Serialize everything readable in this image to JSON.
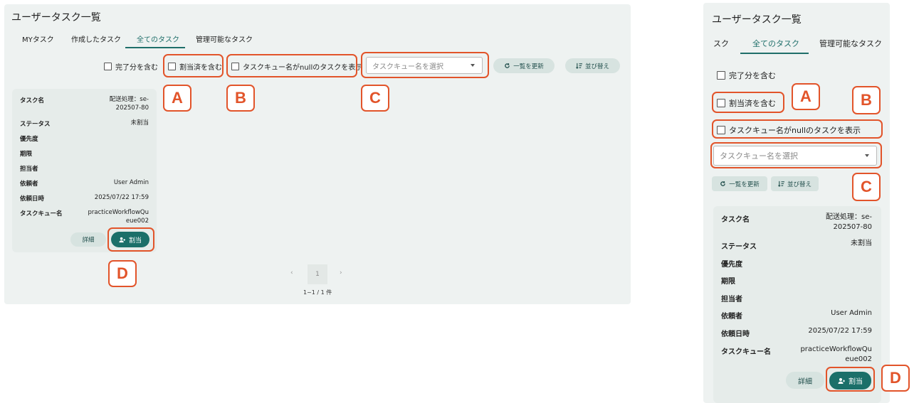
{
  "title": "ユーザータスク一覧",
  "tabs": [
    "MYタスク",
    "作成したタスク",
    "全てのタスク",
    "管理可能なタスク"
  ],
  "tabs_right": [
    "スク",
    "全てのタスク",
    "管理可能なタスク"
  ],
  "filters": {
    "include_completed": "完了分を含む",
    "include_assigned": "割当済を含む",
    "show_null_queue": "タスクキュー名がnullのタスクを表示",
    "queue_placeholder": "タスクキュー名を選択"
  },
  "actions": {
    "refresh": "一覧を更新",
    "sort": "並び替え"
  },
  "task": {
    "labels": [
      "タスク名",
      "ステータス",
      "優先度",
      "期限",
      "担当者",
      "依頼者",
      "依頼日時",
      "タスクキュー名"
    ],
    "name_line1": "配送処理：se-",
    "name_line2": "202507-80",
    "status": "未割当",
    "priority": "",
    "due": "",
    "assignee": "",
    "requester": "User Admin",
    "requested_at": "2025/07/22 17:59",
    "queue_left_1": "practiceWorkflowQu",
    "queue_left_2": "eue002",
    "queue_right_1": "practiceWorkflowQu",
    "queue_right_2": "eue002",
    "detail_button": "詳細",
    "assign_button": "割当"
  },
  "pagination": {
    "page": "1",
    "summary": "1~1 / 1 件"
  },
  "markers": {
    "a": "A",
    "b": "B",
    "c": "C",
    "d": "D"
  },
  "colors": {
    "accent": "#1b6f69",
    "highlight": "#e2542a",
    "panel": "#eef2f1"
  }
}
